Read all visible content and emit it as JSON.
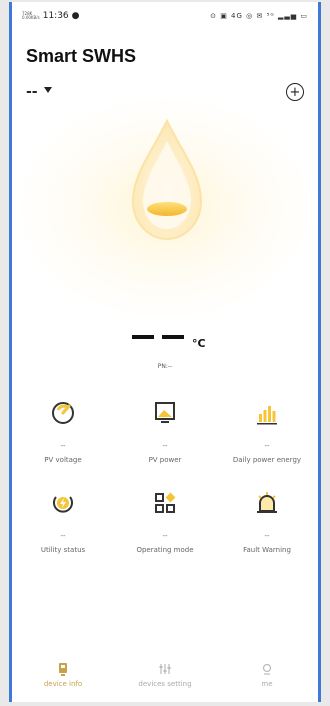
{
  "status_bar": {
    "time": "11:36",
    "left_tiny": [
      "728K",
      "0.00KB/s"
    ],
    "right_indicators": "⊙ ▣ 4G ◎ ✉ ⁵ᴳ ▂▃▅ ▭"
  },
  "app": {
    "title": "Smart SWHS"
  },
  "device": {
    "name": "--"
  },
  "temperature": {
    "value_placeholder": "— —",
    "unit": "°C"
  },
  "pn": "PN:--",
  "metrics": [
    {
      "value": "--",
      "label": "PV voltage",
      "icon": "gauge-icon"
    },
    {
      "value": "--",
      "label": "PV power",
      "icon": "solar-panel-icon"
    },
    {
      "value": "--",
      "label": "Daily power energy",
      "icon": "bar-chart-icon"
    },
    {
      "value": "--",
      "label": "Utility status",
      "icon": "lightning-icon"
    },
    {
      "value": "--",
      "label": "Operating mode",
      "icon": "mode-grid-icon"
    },
    {
      "value": "--",
      "label": "Fault Warning",
      "icon": "alarm-icon"
    }
  ],
  "bottom_nav": [
    {
      "label": "device info",
      "icon": "device-info-icon",
      "active": true
    },
    {
      "label": "devices setting",
      "icon": "settings-icon",
      "active": false
    },
    {
      "label": "me",
      "icon": "user-icon",
      "active": false
    }
  ],
  "colors": {
    "accent": "#f4c534",
    "accent_dark": "#c9a14a",
    "frame_border": "#3c79d8"
  }
}
